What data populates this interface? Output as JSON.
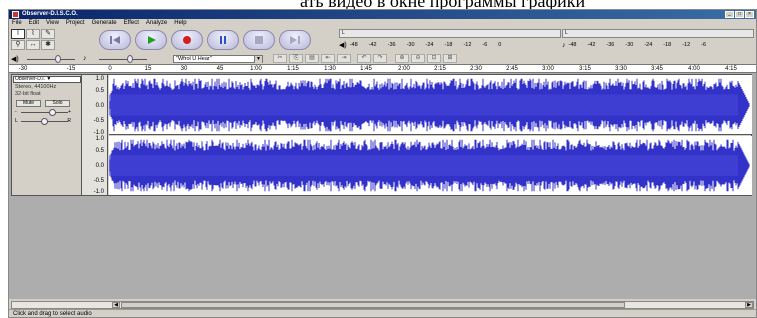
{
  "caption_fragment": "ать видео в окне программы графики",
  "window": {
    "title": "Observer-D.I.S.C.O.",
    "controls": [
      "_",
      "□",
      "×"
    ]
  },
  "menu": [
    "File",
    "Edit",
    "View",
    "Project",
    "Generate",
    "Effect",
    "Analyze",
    "Help"
  ],
  "tools": {
    "selection": "I",
    "envelope": "⌇",
    "draw": "✎",
    "zoom": "⚲",
    "timeshift": "↔",
    "multi": "✱"
  },
  "meters": {
    "out_scale": [
      "-48",
      "-42",
      "-36",
      "-30",
      "-24",
      "-18",
      "-12",
      "-6",
      "0"
    ],
    "in_scale": [
      "-48",
      "-42",
      "-36",
      "-30",
      "-24",
      "-18",
      "-12",
      "-6"
    ],
    "out_channels": [
      "L",
      "R"
    ],
    "in_channels": [
      "L",
      "R"
    ]
  },
  "edit": {
    "input_dropdown": "\"Wfrol U Hear\""
  },
  "ruler": {
    "labels": [
      "-30",
      "-15",
      "0",
      "15",
      "30",
      "45",
      "1:00",
      "1:15",
      "1:30",
      "1:45",
      "2:00",
      "2:15",
      "2:30",
      "2:45",
      "3:00",
      "3:15",
      "3:30",
      "3:45",
      "4:00",
      "4:15"
    ]
  },
  "track": {
    "name": "Observer-D.I. ▼",
    "format": "Stereo, 44100Hz",
    "bitdepth": "32-bit float",
    "mute_label": "Mute",
    "solo_label": "Solo",
    "gain_minus": "-",
    "gain_plus": "+",
    "pan_left": "L",
    "pan_right": "R",
    "scale_labels": [
      "1.0",
      "0.5",
      "0.0",
      "-0.5",
      "-1.0"
    ],
    "waveform_color": "#3232c8",
    "gain_level": 0.7,
    "pan_level": 0.5
  },
  "status": {
    "text": "Click and drag to select audio"
  },
  "colors": {
    "title_bar": "#0a246a",
    "waveform": "#3232c8",
    "track_bg": "#d4d0c8",
    "area_bg": "#adadad"
  }
}
